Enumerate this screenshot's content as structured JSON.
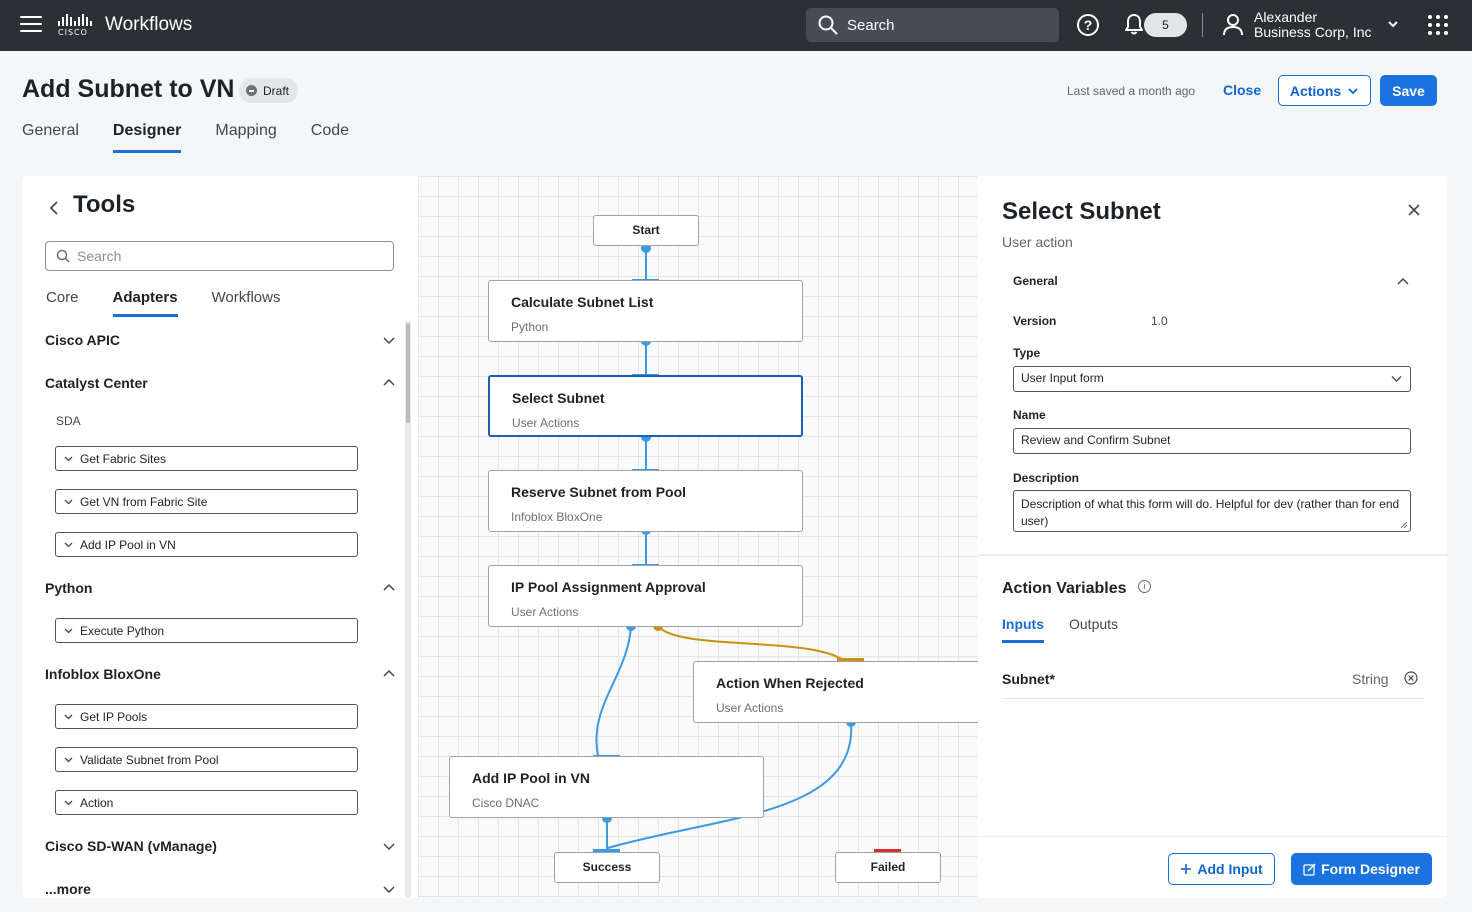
{
  "topbar": {
    "app_title": "Workflows",
    "logo_text": "CISCO",
    "search_label": "Search",
    "notification_count": "5",
    "user_name": "Alexander",
    "user_company": "Business Corp, Inc"
  },
  "page": {
    "title": "Add Subnet to VN",
    "status": "Draft",
    "last_saved": "Last saved a month ago",
    "close_label": "Close",
    "actions_label": "Actions",
    "save_label": "Save"
  },
  "main_tabs": [
    {
      "label": "General",
      "active": false
    },
    {
      "label": "Designer",
      "active": true
    },
    {
      "label": "Mapping",
      "active": false
    },
    {
      "label": "Code",
      "active": false
    }
  ],
  "tools": {
    "title": "Tools",
    "search_placeholder": "Search",
    "tabs": [
      {
        "label": "Core",
        "active": false
      },
      {
        "label": "Adapters",
        "active": true
      },
      {
        "label": "Workflows",
        "active": false
      }
    ],
    "groups": {
      "cisco_apic": "Cisco APIC",
      "catalyst_center": "Catalyst Center",
      "sda": "SDA",
      "python": "Python",
      "infoblox": "Infoblox BloxOne",
      "sdwan": "Cisco SD-WAN (vManage)",
      "more": "...more"
    },
    "items": {
      "get_fabric_sites": "Get Fabric Sites",
      "get_vn_from_fabric_site": "Get VN from Fabric Site",
      "add_ip_pool_in_vn": "Add IP Pool in VN",
      "execute_python": "Execute Python",
      "get_ip_pools": "Get IP Pools",
      "validate_subnet_from_pool": "Validate Subnet from Pool",
      "action": "Action"
    }
  },
  "canvas": {
    "start": "Start",
    "nodes": {
      "calc": {
        "title": "Calculate Subnet List",
        "subtitle": "Python"
      },
      "select": {
        "title": "Select Subnet",
        "subtitle": "User Actions"
      },
      "reserve": {
        "title": "Reserve Subnet from Pool",
        "subtitle": "Infoblox BloxOne"
      },
      "approval": {
        "title": "IP Pool Assignment Approval",
        "subtitle": "User Actions"
      },
      "rejected": {
        "title": "Action When Rejected",
        "subtitle": "User Actions"
      },
      "addpool": {
        "title": "Add IP Pool in VN",
        "subtitle": "Cisco DNAC"
      }
    },
    "success": "Success",
    "failed": "Failed"
  },
  "details": {
    "title": "Select Subnet",
    "subtitle": "User action",
    "section": "General",
    "version_label": "Version",
    "version_value": "1.0",
    "type_label": "Type",
    "type_value": "User Input form",
    "name_label": "Name",
    "name_value": "Review and Confirm Subnet",
    "description_label": "Description",
    "description_value": "Description of what this form will do. Helpful for dev (rather than for end user)",
    "action_variables_title": "Action Variables",
    "av_tabs": [
      {
        "label": "Inputs",
        "active": true
      },
      {
        "label": "Outputs",
        "active": false
      }
    ],
    "variables": [
      {
        "name": "Subnet*",
        "type": "String"
      }
    ],
    "add_input_label": "Add Input",
    "form_designer_label": "Form Designer"
  },
  "colors": {
    "accent": "#1a6fd6",
    "wire_success": "#3b9ae1",
    "wire_reject": "#c8920a",
    "fail_marker": "#d62e2e",
    "topbar": "#2b3035"
  }
}
